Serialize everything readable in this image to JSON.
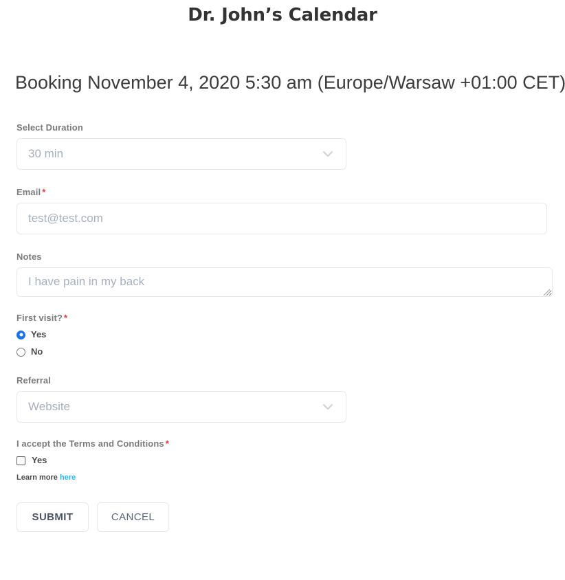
{
  "header": {
    "title": "Dr. John’s Calendar",
    "booking_line": "Booking November 4, 2020 5:30 am (Europe/Warsaw +01:00 CET)"
  },
  "form": {
    "duration": {
      "label": "Select Duration",
      "value": "30 min",
      "icon": "chevron-down-icon"
    },
    "email": {
      "label": "Email",
      "required_mark": "*",
      "placeholder": "test@test.com",
      "value": ""
    },
    "notes": {
      "label": "Notes",
      "placeholder": "I have pain in my back",
      "value": ""
    },
    "first_visit": {
      "label": "First visit?",
      "required_mark": "*",
      "options": [
        {
          "label": "Yes",
          "selected": true
        },
        {
          "label": "No",
          "selected": false
        }
      ]
    },
    "referral": {
      "label": "Referral",
      "value": "Website",
      "icon": "chevron-down-icon"
    },
    "terms": {
      "label": "I accept the Terms and Conditions",
      "required_mark": "*",
      "checkbox_label": "Yes",
      "checked": false,
      "learn_more_text": "Learn more",
      "learn_more_link": "here"
    }
  },
  "actions": {
    "submit_label": "SUBMIT",
    "cancel_label": "CANCEL"
  },
  "colors": {
    "accent_radio": "#1a73e8",
    "link": "#29b6f6",
    "required": "#e53935",
    "label": "#7b7b7b",
    "border": "#e4e8ed"
  }
}
